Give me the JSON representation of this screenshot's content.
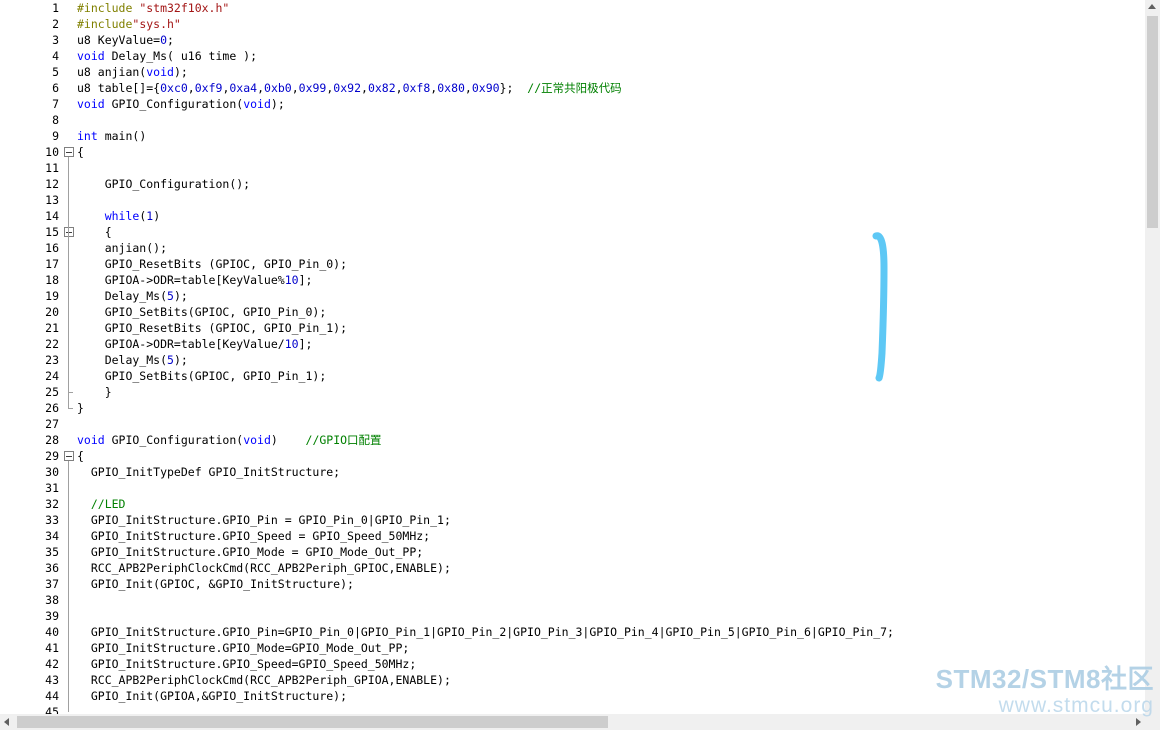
{
  "editor": {
    "lines": [
      {
        "n": "1",
        "t": [
          [
            "pp",
            "#include "
          ],
          [
            "str",
            "\"stm32f10x.h\""
          ]
        ]
      },
      {
        "n": "2",
        "t": [
          [
            "pp",
            "#include"
          ],
          [
            "str",
            "\"sys.h\""
          ]
        ]
      },
      {
        "n": "3",
        "t": [
          [
            "",
            "u8 KeyValue="
          ],
          [
            "num",
            "0"
          ],
          [
            "",
            ";"
          ]
        ]
      },
      {
        "n": "4",
        "t": [
          [
            "kw",
            "void"
          ],
          [
            "",
            " Delay_Ms( u16 time );"
          ]
        ]
      },
      {
        "n": "5",
        "t": [
          [
            "",
            "u8 anjian("
          ],
          [
            "kw",
            "void"
          ],
          [
            "",
            ");"
          ]
        ]
      },
      {
        "n": "6",
        "t": [
          [
            "",
            "u8 table[]={"
          ],
          [
            "num",
            "0xc0"
          ],
          [
            "",
            ","
          ],
          [
            "num",
            "0xf9"
          ],
          [
            "",
            ","
          ],
          [
            "num",
            "0xa4"
          ],
          [
            "",
            ","
          ],
          [
            "num",
            "0xb0"
          ],
          [
            "",
            ","
          ],
          [
            "num",
            "0x99"
          ],
          [
            "",
            ","
          ],
          [
            "num",
            "0x92"
          ],
          [
            "",
            ","
          ],
          [
            "num",
            "0x82"
          ],
          [
            "",
            ","
          ],
          [
            "num",
            "0xf8"
          ],
          [
            "",
            ","
          ],
          [
            "num",
            "0x80"
          ],
          [
            "",
            ","
          ],
          [
            "num",
            "0x90"
          ],
          [
            "",
            "};  "
          ],
          [
            "cm",
            "//正常共阳极代码"
          ]
        ]
      },
      {
        "n": "7",
        "t": [
          [
            "kw",
            "void"
          ],
          [
            "",
            " GPIO_Configuration("
          ],
          [
            "kw",
            "void"
          ],
          [
            "",
            ");"
          ]
        ]
      },
      {
        "n": "8",
        "t": []
      },
      {
        "n": "9",
        "t": [
          [
            "kw",
            "int"
          ],
          [
            "",
            " main()"
          ]
        ]
      },
      {
        "n": "10",
        "t": [
          [
            "",
            "{"
          ]
        ]
      },
      {
        "n": "11",
        "t": []
      },
      {
        "n": "12",
        "t": [
          [
            "",
            "    GPIO_Configuration();"
          ]
        ]
      },
      {
        "n": "13",
        "t": []
      },
      {
        "n": "14",
        "t": [
          [
            "",
            "    "
          ],
          [
            "kw",
            "while"
          ],
          [
            "",
            "("
          ],
          [
            "num",
            "1"
          ],
          [
            "",
            ")"
          ]
        ]
      },
      {
        "n": "15",
        "t": [
          [
            "",
            "    {"
          ]
        ]
      },
      {
        "n": "16",
        "t": [
          [
            "",
            "    anjian();"
          ]
        ]
      },
      {
        "n": "17",
        "t": [
          [
            "",
            "    GPIO_ResetBits (GPIOC, GPIO_Pin_0);"
          ]
        ]
      },
      {
        "n": "18",
        "t": [
          [
            "",
            "    GPIOA->ODR=table[KeyValue%"
          ],
          [
            "num",
            "10"
          ],
          [
            "",
            "];"
          ]
        ]
      },
      {
        "n": "19",
        "t": [
          [
            "",
            "    Delay_Ms("
          ],
          [
            "num",
            "5"
          ],
          [
            "",
            ");"
          ]
        ]
      },
      {
        "n": "20",
        "t": [
          [
            "",
            "    GPIO_SetBits(GPIOC, GPIO_Pin_0);"
          ]
        ]
      },
      {
        "n": "21",
        "t": [
          [
            "",
            "    GPIO_ResetBits (GPIOC, GPIO_Pin_1);"
          ]
        ]
      },
      {
        "n": "22",
        "t": [
          [
            "",
            "    GPIOA->ODR=table[KeyValue/"
          ],
          [
            "num",
            "10"
          ],
          [
            "",
            "];"
          ]
        ]
      },
      {
        "n": "23",
        "t": [
          [
            "",
            "    Delay_Ms("
          ],
          [
            "num",
            "5"
          ],
          [
            "",
            ");"
          ]
        ]
      },
      {
        "n": "24",
        "t": [
          [
            "",
            "    GPIO_SetBits(GPIOC, GPIO_Pin_1);"
          ]
        ]
      },
      {
        "n": "25",
        "t": [
          [
            "",
            "    }"
          ]
        ]
      },
      {
        "n": "26",
        "t": [
          [
            "",
            "}"
          ]
        ]
      },
      {
        "n": "27",
        "t": []
      },
      {
        "n": "28",
        "t": [
          [
            "kw",
            "void"
          ],
          [
            "",
            " GPIO_Configuration("
          ],
          [
            "kw",
            "void"
          ],
          [
            "",
            ")    "
          ],
          [
            "cm",
            "//GPIO口配置"
          ]
        ]
      },
      {
        "n": "29",
        "t": [
          [
            "",
            "{"
          ]
        ]
      },
      {
        "n": "30",
        "t": [
          [
            "",
            "  GPIO_InitTypeDef GPIO_InitStructure;"
          ]
        ]
      },
      {
        "n": "31",
        "t": []
      },
      {
        "n": "32",
        "t": [
          [
            "",
            "  "
          ],
          [
            "cm",
            "//LED"
          ]
        ]
      },
      {
        "n": "33",
        "t": [
          [
            "",
            "  GPIO_InitStructure.GPIO_Pin = GPIO_Pin_0|GPIO_Pin_1;"
          ]
        ]
      },
      {
        "n": "34",
        "t": [
          [
            "",
            "  GPIO_InitStructure.GPIO_Speed = GPIO_Speed_50MHz;"
          ]
        ]
      },
      {
        "n": "35",
        "t": [
          [
            "",
            "  GPIO_InitStructure.GPIO_Mode = GPIO_Mode_Out_PP;"
          ]
        ]
      },
      {
        "n": "36",
        "t": [
          [
            "",
            "  RCC_APB2PeriphClockCmd(RCC_APB2Periph_GPIOC,ENABLE);"
          ]
        ]
      },
      {
        "n": "37",
        "t": [
          [
            "",
            "  GPIO_Init(GPIOC, &GPIO_InitStructure);"
          ]
        ]
      },
      {
        "n": "38",
        "t": []
      },
      {
        "n": "39",
        "t": []
      },
      {
        "n": "40",
        "t": [
          [
            "",
            "  GPIO_InitStructure.GPIO_Pin=GPIO_Pin_0|GPIO_Pin_1|GPIO_Pin_2|GPIO_Pin_3|GPIO_Pin_4|GPIO_Pin_5|GPIO_Pin_6|GPIO_Pin_7;"
          ]
        ]
      },
      {
        "n": "41",
        "t": [
          [
            "",
            "  GPIO_InitStructure.GPIO_Mode=GPIO_Mode_Out_PP;"
          ]
        ]
      },
      {
        "n": "42",
        "t": [
          [
            "",
            "  GPIO_InitStructure.GPIO_Speed=GPIO_Speed_50MHz;"
          ]
        ]
      },
      {
        "n": "43",
        "t": [
          [
            "",
            "  RCC_APB2PeriphClockCmd(RCC_APB2Periph_GPIOA,ENABLE);"
          ]
        ]
      },
      {
        "n": "44",
        "t": [
          [
            "",
            "  GPIO_Init(GPIOA,&GPIO_InitStructure);"
          ]
        ]
      },
      {
        "n": "45",
        "t": []
      }
    ],
    "fold_markers": [
      "10",
      "15",
      "29"
    ]
  },
  "watermark": {
    "title": "STM32/STM8社区",
    "url": "www.stmcu.org"
  },
  "colors": {
    "keyword": "#0000ff",
    "preprocessor": "#808000",
    "string": "#a31515",
    "number": "#0000cc",
    "comment": "#008000",
    "annotation_stroke": "#5ec8f5"
  },
  "icons": {
    "fold_toggle": "minus-box-icon",
    "scroll_up": "arrow-up-icon",
    "scroll_left": "arrow-left-icon",
    "scroll_right": "arrow-right-icon"
  }
}
